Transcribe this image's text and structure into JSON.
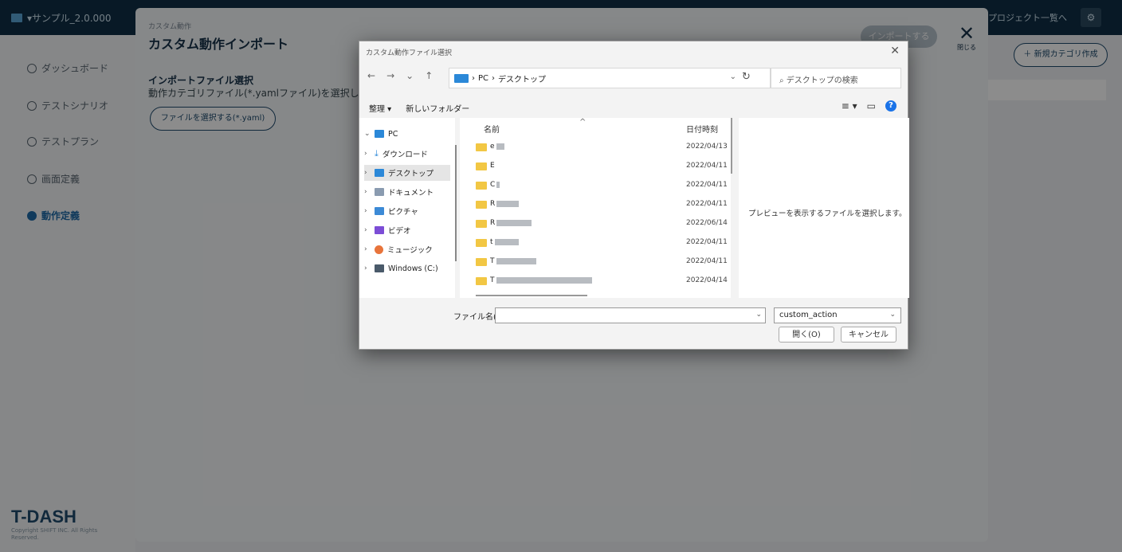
{
  "app": {
    "project": "▾サンプル_2.0.000",
    "project_list_link": "プロジェクト一覧へ",
    "new_category_button": "＋ 新規カテゴリ作成",
    "logo": "T-DASH",
    "copyright": "Copyright SHIFT INC. All Rights Reserved."
  },
  "sidebar": {
    "items": [
      {
        "label": "ダッシュボード"
      },
      {
        "label": "テストシナリオ"
      },
      {
        "label": "テストプラン"
      },
      {
        "label": "画面定義"
      },
      {
        "label": "動作定義"
      }
    ]
  },
  "panel": {
    "subtitle": "カスタム動作",
    "title": "カスタム動作インポート",
    "import_button": "インポートする",
    "close_label": "閉じる",
    "section_title": "インポートファイル選択",
    "section_desc": "動作カテゴリファイル(*.yamlファイル)を選択してください",
    "pick_button": "ファイルを選択する(*.yaml)"
  },
  "dialog": {
    "title": "カスタム動作ファイル選択",
    "breadcrumb": [
      "PC",
      "デスクトップ"
    ],
    "search_placeholder": "デスクトップの検索",
    "toolbar": {
      "organize": "整理 ▾",
      "new_folder": "新しいフォルダー"
    },
    "tree": [
      {
        "label": "PC",
        "expanded": true
      },
      {
        "label": "ダウンロード"
      },
      {
        "label": "デスクトップ",
        "selected": true
      },
      {
        "label": "ドキュメント"
      },
      {
        "label": "ピクチャ"
      },
      {
        "label": "ビデオ"
      },
      {
        "label": "ミュージック"
      },
      {
        "label": "Windows (C:)"
      }
    ],
    "columns": {
      "name": "名前",
      "date": "日付時刻"
    },
    "files": [
      {
        "name": "e",
        "date": "2022/04/13"
      },
      {
        "name": "E",
        "date": "2022/04/11"
      },
      {
        "name": "C",
        "date": "2022/04/11"
      },
      {
        "name": "R",
        "date": "2022/04/11"
      },
      {
        "name": "R",
        "date": "2022/06/14"
      },
      {
        "name": "t",
        "date": "2022/04/11"
      },
      {
        "name": "T",
        "date": "2022/04/11"
      },
      {
        "name": "T",
        "date": "2022/04/14"
      }
    ],
    "preview_text": "プレビューを表示するファイルを選択します。",
    "filename_label": "ファイル名(N):",
    "filename_value": "",
    "filter": "custom_action",
    "open_button": "開く(O)",
    "cancel_button": "キャンセル"
  }
}
